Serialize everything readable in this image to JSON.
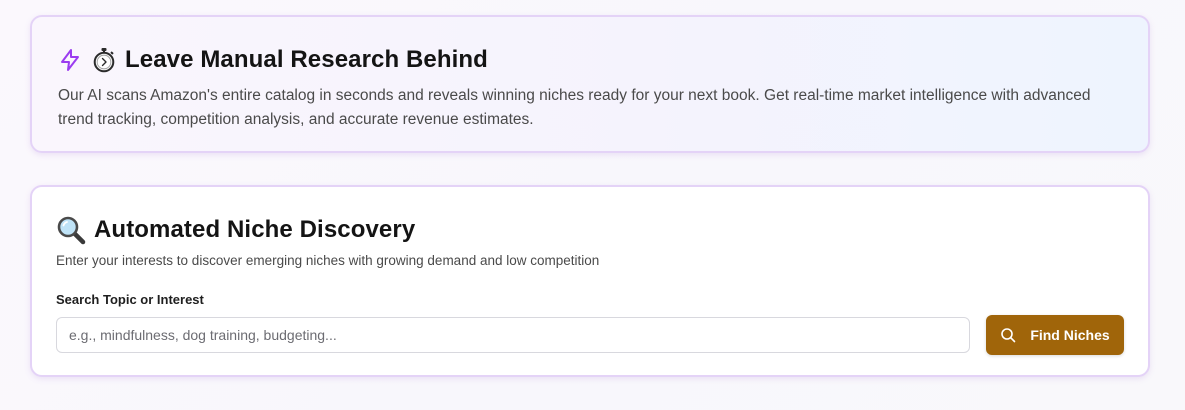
{
  "intro_card": {
    "icons": [
      "lightning-bolt-icon",
      "stopwatch-icon"
    ],
    "title": "Leave Manual Research Behind",
    "description": "Our AI scans Amazon's entire catalog in seconds and reveals winning niches ready for your next book. Get real-time market intelligence with advanced trend tracking, competition analysis, and accurate revenue estimates."
  },
  "discovery_card": {
    "icon": "magnifying-glass-icon",
    "title": "Automated Niche Discovery",
    "subtitle": "Enter your interests to discover emerging niches with growing demand and low competition",
    "search": {
      "label": "Search Topic or Interest",
      "value": "",
      "placeholder": "e.g., mindfulness, dog training, budgeting..."
    },
    "button": {
      "icon": "search-icon",
      "label": "Find Niches"
    }
  },
  "colors": {
    "accent_purple": "#9b3cf0",
    "card_border": "#e4d3f7",
    "button_bg": "#a0650a",
    "button_text": "#ffffff"
  }
}
